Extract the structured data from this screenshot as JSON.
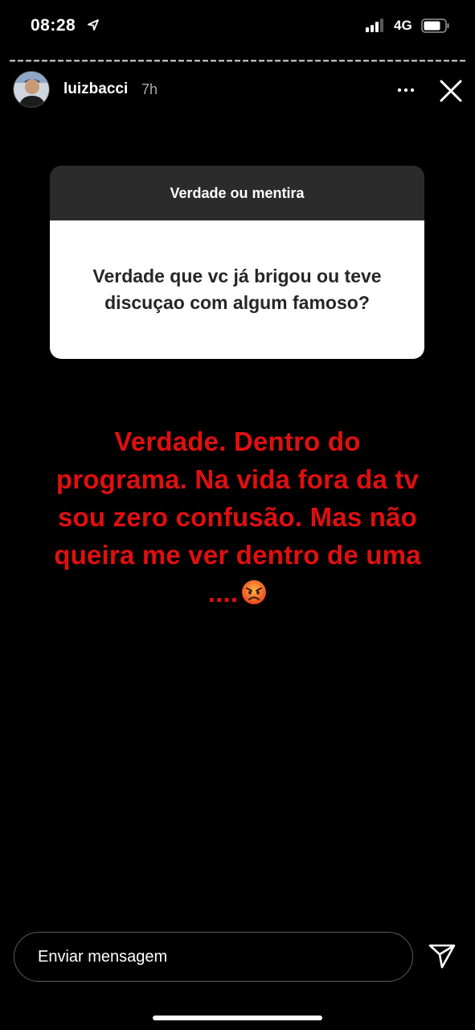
{
  "status_bar": {
    "time": "08:28",
    "network": "4G",
    "icons": [
      "location-arrow-icon",
      "signal-bars-icon",
      "battery-icon"
    ]
  },
  "story": {
    "username": "luizbacci",
    "time_ago": "7h",
    "icons": [
      "more-options-icon",
      "close-icon"
    ]
  },
  "question_card": {
    "header": "Verdade ou mentira",
    "question": "Verdade que vc já brigou ou teve discuçao com algum famoso?"
  },
  "answer": {
    "text": "Verdade. Dentro do programa. Na vida fora da tv sou zero confusão. Mas não queira me ver dentro de uma ....",
    "emoji": "angry-face-emoji",
    "color": "#e10f0f"
  },
  "reply_bar": {
    "placeholder": "Enviar mensagem",
    "send_icon": "send-icon"
  }
}
